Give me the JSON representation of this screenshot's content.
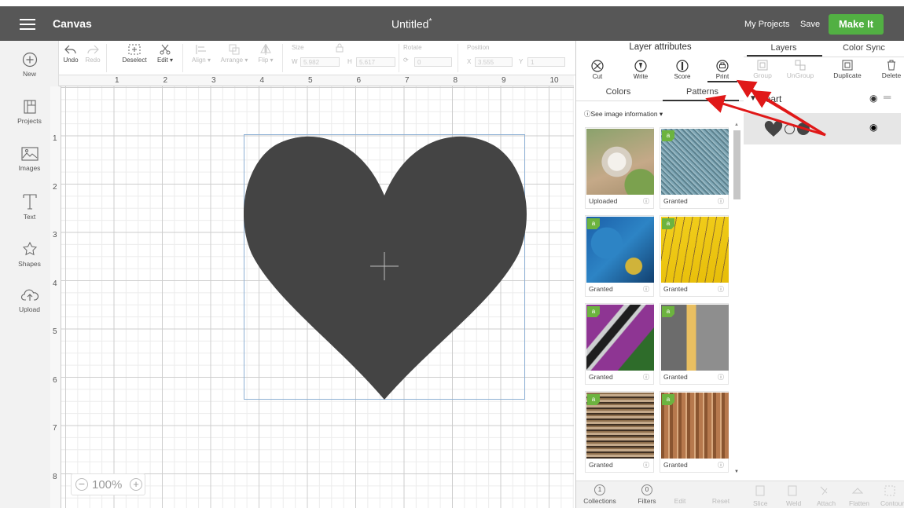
{
  "header": {
    "app_title": "Canvas",
    "doc_title": "Untitled",
    "doc_modified_mark": "*",
    "my_projects": "My Projects",
    "save": "Save",
    "make_it": "Make It"
  },
  "sidebar": {
    "items": [
      {
        "label": "New",
        "icon": "plus-circle-icon"
      },
      {
        "label": "Projects",
        "icon": "projects-icon"
      },
      {
        "label": "Images",
        "icon": "image-icon"
      },
      {
        "label": "Text",
        "icon": "text-icon"
      },
      {
        "label": "Shapes",
        "icon": "shapes-icon"
      },
      {
        "label": "Upload",
        "icon": "upload-icon"
      }
    ]
  },
  "toolbar": {
    "undo": "Undo",
    "redo": "Redo",
    "deselect": "Deselect",
    "edit": "Edit",
    "align": "Align",
    "arrange": "Arrange",
    "flip": "Flip",
    "size_label": "Size",
    "w_label": "W",
    "w_value": "5.982",
    "h_label": "H",
    "h_value": "5.617",
    "rotate_label": "Rotate",
    "rotate_value": "0",
    "position_label": "Position",
    "x_label": "X",
    "x_value": "3.555",
    "y_label": "Y",
    "y_value": "1"
  },
  "ruler": {
    "x_ticks": [
      "1",
      "2",
      "3",
      "4",
      "5",
      "6",
      "7",
      "8",
      "9",
      "10"
    ],
    "y_ticks": [
      "1",
      "2",
      "3",
      "4",
      "5",
      "6",
      "7",
      "8"
    ]
  },
  "canvas": {
    "shape_color": "#444444",
    "zoom_level": "100%"
  },
  "layer_attributes": {
    "title": "Layer attributes",
    "buttons": [
      {
        "label": "Cut",
        "icon": "cut-icon"
      },
      {
        "label": "Write",
        "icon": "write-icon"
      },
      {
        "label": "Score",
        "icon": "score-icon"
      },
      {
        "label": "Print",
        "icon": "print-icon"
      }
    ],
    "tabs": [
      "Colors",
      "Patterns"
    ],
    "active_tab": "Patterns",
    "see_info": "See image information",
    "patterns": [
      {
        "label": "Uploaded",
        "colors": [
          "#8aa26c",
          "#d9d2c4",
          "#c5a988"
        ],
        "badge": false
      },
      {
        "label": "Granted",
        "colors": [
          "#7fa7b6",
          "#5c828f",
          "#a7c3cc"
        ],
        "badge": true
      },
      {
        "label": "Granted",
        "colors": [
          "#1b5fa8",
          "#2d84c5",
          "#d0b33a"
        ],
        "badge": true
      },
      {
        "label": "Granted",
        "colors": [
          "#f2cf1d",
          "#e7bd08",
          "#8d6d2c"
        ],
        "badge": true
      },
      {
        "label": "Granted",
        "colors": [
          "#8e3593",
          "#2e6c2a",
          "#cdcfd0"
        ],
        "badge": true
      },
      {
        "label": "Granted",
        "colors": [
          "#6c6c6c",
          "#8e8e8e",
          "#e9bf61"
        ],
        "badge": true
      },
      {
        "label": "Granted",
        "colors": [
          "#8d6e4c",
          "#c4a98a",
          "#3e2f22"
        ],
        "badge": true
      },
      {
        "label": "Granted",
        "colors": [
          "#8a5530",
          "#b7794d",
          "#d9a97e"
        ],
        "badge": true
      }
    ],
    "bottom": {
      "collections": "Collections",
      "collections_count": "1",
      "filters": "Filters",
      "filters_count": "0",
      "edit": "Edit",
      "reset": "Reset"
    }
  },
  "layers_panel": {
    "tabs": [
      "Layers",
      "Color Sync"
    ],
    "active_tab": "Layers",
    "actions": [
      {
        "label": "Group",
        "enabled": false
      },
      {
        "label": "UnGroup",
        "enabled": false
      },
      {
        "label": "Duplicate",
        "enabled": true
      },
      {
        "label": "Delete",
        "enabled": true
      }
    ],
    "group_name": "Heart",
    "bottom": [
      "Slice",
      "Weld",
      "Attach",
      "Flatten",
      "Contour"
    ]
  },
  "annotation_color": "#e01818"
}
